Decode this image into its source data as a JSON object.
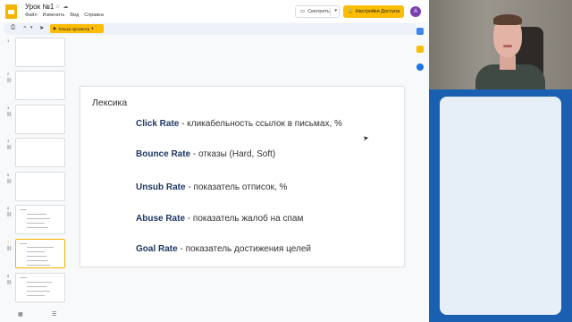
{
  "app": {
    "doc_title": "Урок №1",
    "menu": [
      "Файл",
      "Изменить",
      "Вид",
      "Справка"
    ],
    "watch_label": "Смотреть",
    "access_label": "Настройки Доступа",
    "avatar_letter": "A",
    "view_only_label": "Только просмотр"
  },
  "filmstrip": {
    "slides": [
      {
        "num": "1"
      },
      {
        "num": "2"
      },
      {
        "num": "3"
      },
      {
        "num": "4"
      },
      {
        "num": "5"
      },
      {
        "num": "6"
      },
      {
        "num": "7"
      },
      {
        "num": "8"
      }
    ],
    "selected": "7"
  },
  "slide": {
    "title": "Лексика",
    "items": [
      {
        "term": "Click Rate",
        "desc": " - кликабельность ссылок в письмах, %"
      },
      {
        "term": "Bounce Rate",
        "desc": " - отказы (Hard, Soft)"
      },
      {
        "term": "Unsub Rate",
        "desc": " - показатель отписок, %"
      },
      {
        "term": "Abuse Rate",
        "desc": " - показатель жалоб на спам"
      },
      {
        "term": "Goal Rate",
        "desc": " - показатель достижения целей"
      }
    ]
  },
  "colors": {
    "accent": "#fbbc04",
    "term": "#1f3864",
    "side_panel": "#1a5fb0",
    "avatar": "#7b3fb5"
  },
  "icons": [
    "docs-logo",
    "star-icon",
    "cloud-icon",
    "share-icon",
    "print-icon",
    "zoom-icon",
    "cursor-icon",
    "pencil-icon",
    "chevron-up-icon",
    "calendar-icon",
    "keep-icon",
    "tasks-icon",
    "grid-view-icon",
    "list-view-icon",
    "link-icon"
  ]
}
